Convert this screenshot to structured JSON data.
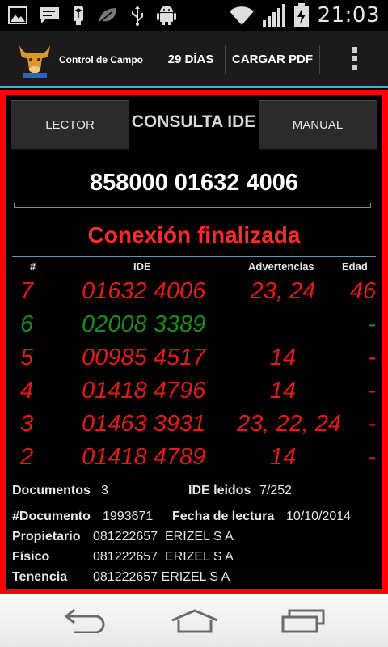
{
  "status_bar": {
    "time": "21:03",
    "left_icons": [
      "image-icon",
      "message-icon",
      "usb-debug-icon",
      "leaf-icon",
      "usb-icon",
      "android-icon"
    ],
    "right_icons": [
      "wifi-icon",
      "signal-icon",
      "battery-charging-icon"
    ]
  },
  "action_bar": {
    "app_title": "Control de Campo",
    "days_label": "29 DÍAS",
    "pdf_label": "CARGAR PDF",
    "accent_color": "#33b5e5"
  },
  "main": {
    "lector_label": "LECTOR",
    "consulta_label": "CONSULTA IDE",
    "manual_label": "MANUAL",
    "ide_value": "858000 01632 4006",
    "status_text": "Conexión finalizada",
    "status_color": "#ff2a2a",
    "frame_color": "#ff0000",
    "table": {
      "headers": [
        "#",
        "IDE",
        "Advertencias",
        "Edad"
      ],
      "rows": [
        {
          "num": "7",
          "ide": "01632 4006",
          "advertencias": "23, 24",
          "edad": "46",
          "color": "#e01b1b"
        },
        {
          "num": "6",
          "ide": "02008 3389",
          "advertencias": "",
          "edad": "-",
          "color": "#1e8a1e"
        },
        {
          "num": "5",
          "ide": "00985 4517",
          "advertencias": "14",
          "edad": "-",
          "color": "#e01b1b"
        },
        {
          "num": "4",
          "ide": "01418 4796",
          "advertencias": "14",
          "edad": "-",
          "color": "#e01b1b"
        },
        {
          "num": "3",
          "ide": "01463 3931",
          "advertencias": "23, 22, 24",
          "edad": "-",
          "color": "#e01b1b"
        },
        {
          "num": "2",
          "ide": "01418 4789",
          "advertencias": "14",
          "edad": "-",
          "color": "#e01b1b"
        }
      ]
    },
    "summary": {
      "documentos_label": "Documentos",
      "documentos_value": "3",
      "ide_leidos_label": "IDE leidos",
      "ide_leidos_value": "7/252"
    },
    "details": {
      "documento_label": "#Documento",
      "documento_value": "1993671",
      "fecha_label": "Fecha de lectura",
      "fecha_value": "10/10/2014",
      "propietario_label": "Propietario",
      "propietario_value": "081222657  ERIZEL S A",
      "fisico_label": "Físico",
      "fisico_value": "081222657  ERIZEL S A",
      "tenencia_label": "Tenencia",
      "tenencia_value": "081222657 ERIZEL S A"
    }
  },
  "nav_bar": {
    "icons": [
      "back-icon",
      "home-icon",
      "recent-apps-icon"
    ]
  }
}
